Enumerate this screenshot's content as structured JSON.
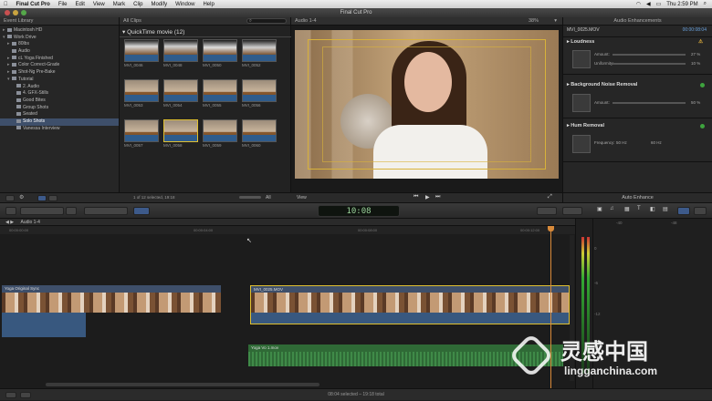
{
  "menubar": {
    "app_name": "Final Cut Pro",
    "items": [
      "File",
      "Edit",
      "View",
      "Mark",
      "Clip",
      "Modify",
      "Window",
      "Help"
    ],
    "clock": "Thu 2:59 PM"
  },
  "window": {
    "title": "Final Cut Pro"
  },
  "library": {
    "header": "Event Library",
    "items": [
      {
        "label": "Macintosh HD",
        "level": 0
      },
      {
        "label": "Work Drive",
        "level": 0
      },
      {
        "label": "80lbs",
        "level": 1
      },
      {
        "label": "Audio",
        "level": 1
      },
      {
        "label": "cL Yoga Finished",
        "level": 1
      },
      {
        "label": "Color Correct-Grade",
        "level": 1
      },
      {
        "label": "Shot-Ng Pre-Bake",
        "level": 1
      },
      {
        "label": "Tutorial",
        "level": 1
      },
      {
        "label": "2. Audio",
        "level": 2
      },
      {
        "label": "4. GFX-Stills",
        "level": 2
      },
      {
        "label": "Good Bites",
        "level": 2
      },
      {
        "label": "Group Shots",
        "level": 2
      },
      {
        "label": "Seated",
        "level": 2
      },
      {
        "label": "Solo Shots",
        "level": 2,
        "selected": true
      },
      {
        "label": "Vanessa Interview",
        "level": 2
      }
    ]
  },
  "browser": {
    "filter": "All Clips",
    "group_title": "QuickTime movie",
    "group_count": "(12)",
    "clips": [
      "MVI_0046",
      "MVI_0048",
      "MVI_0050",
      "MVI_0052",
      "MVI_0053",
      "MVI_0054",
      "MVI_0055",
      "MVI_0056",
      "MVI_0057",
      "MVI_0058",
      "MVI_0059",
      "MVI_0060"
    ],
    "status": "1 of 12 selected, 19:18",
    "all_label": "All"
  },
  "viewer": {
    "header": "Audio 1-4",
    "zoom": "38%",
    "view_menu": "View"
  },
  "inspector": {
    "header": "Audio Enhancements",
    "clip_name": "MVI_0025.MOV",
    "timecode": "00:00:08:04",
    "sections": [
      {
        "title": "Loudness",
        "rows": [
          {
            "label": "Amount:",
            "value": "27 %"
          },
          {
            "label": "Uniformity:",
            "value": "10 %"
          }
        ]
      },
      {
        "title": "Background Noise Removal",
        "rows": [
          {
            "label": "Amount:",
            "value": "50 %"
          }
        ]
      },
      {
        "title": "Hum Removal",
        "rows": [
          {
            "label": "Frequency:",
            "value": "50 Hz"
          },
          {
            "label": "",
            "value": "60 Hz"
          }
        ]
      }
    ],
    "auto_enhance": "Auto Enhance"
  },
  "timeline": {
    "project": "Audio 1-4",
    "timecode": "10:08",
    "ruler": [
      "00:00:00:00",
      "00:00:04:00",
      "00:00:08:00",
      "00:00:12:00"
    ],
    "primary_clip_left": "Yoga Original Sync",
    "primary_clip_right": "MVI_0025.MOV",
    "audio_clip": "Yoga Vo 1.mov"
  },
  "meters": {
    "labels": [
      "0",
      "-6",
      "-12",
      "-20"
    ],
    "top_labels": [
      "-40",
      "-48"
    ]
  },
  "statusbar": {
    "text": "08:04 selected – 19:18 total"
  },
  "watermark": {
    "brand": "灵感中国",
    "url": "lingganchina.com"
  }
}
